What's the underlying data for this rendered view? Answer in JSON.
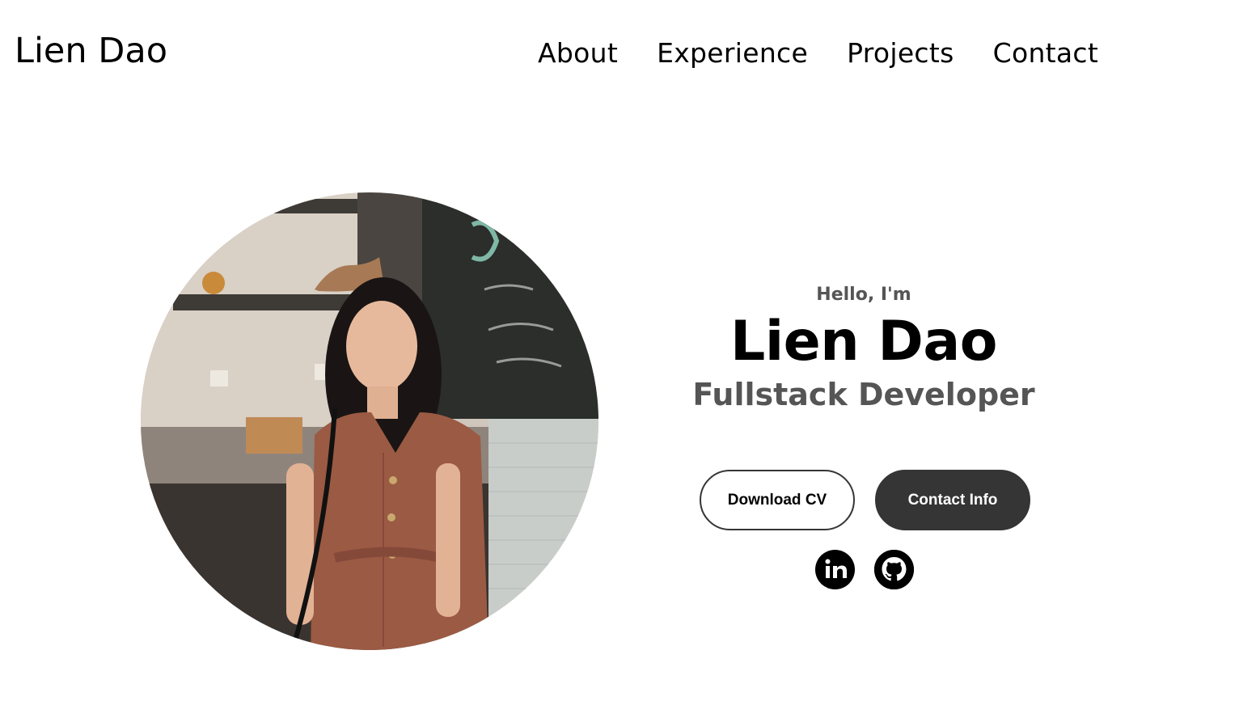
{
  "nav": {
    "logo": "Lien Dao",
    "links": [
      "About",
      "Experience",
      "Projects",
      "Contact"
    ]
  },
  "profile": {
    "image_alt": "Profile photo of Lien Dao",
    "hello": "Hello, I'm",
    "name": "Lien Dao",
    "role": "Fullstack Developer",
    "buttons": {
      "download_cv": "Download CV",
      "contact_info": "Contact Info"
    },
    "socials": [
      {
        "name": "linkedin-icon"
      },
      {
        "name": "github-icon"
      }
    ]
  },
  "colors": {
    "text": "#000000",
    "muted": "#555555",
    "button_dark": "#353535",
    "background": "#ffffff"
  }
}
